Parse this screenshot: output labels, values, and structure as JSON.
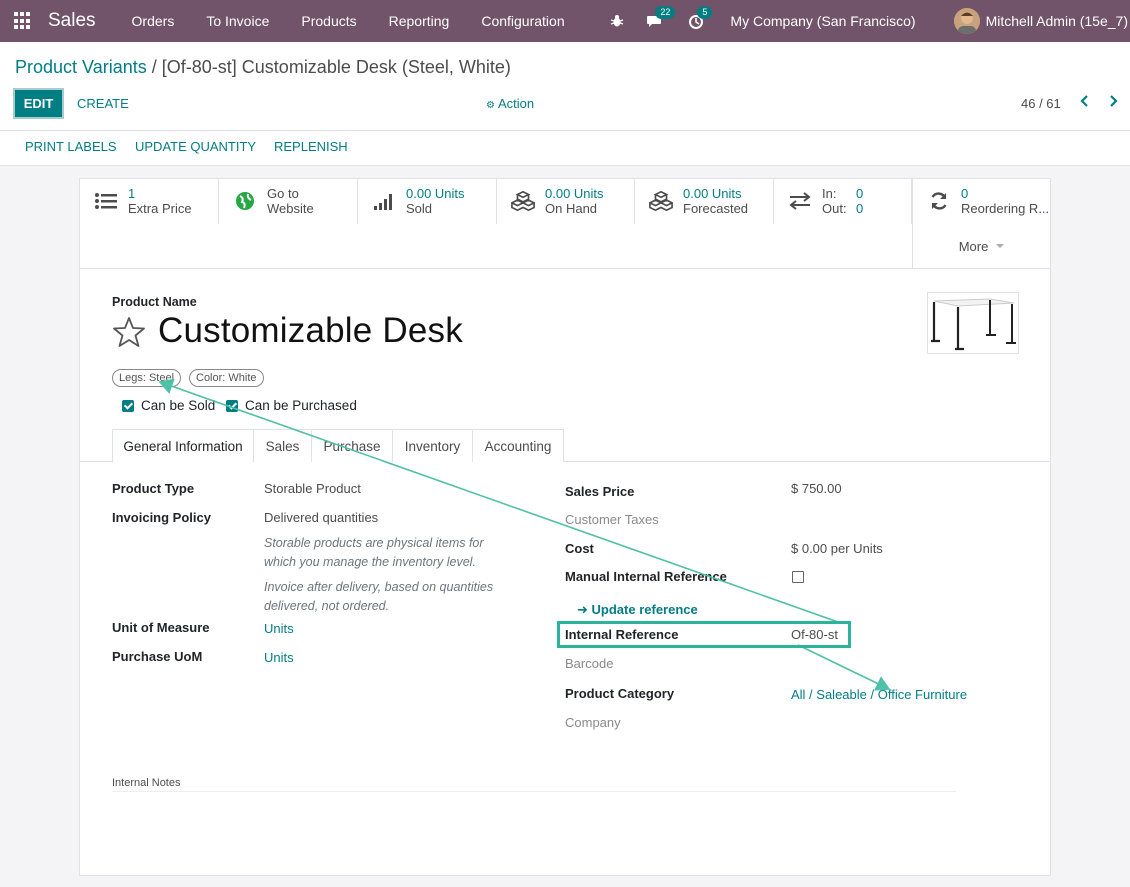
{
  "navbar": {
    "brand": "Sales",
    "menu": [
      "Orders",
      "To Invoice",
      "Products",
      "Reporting",
      "Configuration"
    ],
    "chat_badge": "22",
    "activity_badge": "5",
    "company": "My Company (San Francisco)",
    "user": "Mitchell Admin (15e_7)"
  },
  "breadcrumb": {
    "parent": "Product Variants",
    "separator": "/",
    "current": "[Of-80-st] Customizable Desk (Steel, White)"
  },
  "toolbar": {
    "edit": "EDIT",
    "create": "CREATE",
    "action": "Action",
    "pager": "46 / 61"
  },
  "statusbar": {
    "buttons": [
      "PRINT LABELS",
      "UPDATE QUANTITY",
      "REPLENISH"
    ]
  },
  "smart_buttons": {
    "extra_price_value": "1",
    "extra_price_label": "Extra Price",
    "website_line1": "Go to",
    "website_line2": "Website",
    "sold_value": "0.00 Units",
    "sold_label": "Sold",
    "onhand_value": "0.00 Units",
    "onhand_label": "On Hand",
    "forecast_value": "0.00 Units",
    "forecast_label": "Forecasted",
    "in_label": "In:",
    "in_value": "0",
    "out_label": "Out:",
    "out_value": "0",
    "reorder_value": "0",
    "reorder_label": "Reordering R...",
    "more": "More"
  },
  "product": {
    "name_label": "Product Name",
    "name": "Customizable Desk",
    "tags": [
      "Legs: Steel",
      "Color: White"
    ],
    "can_be_sold": "Can be Sold",
    "can_be_purchased": "Can be Purchased"
  },
  "tabs": [
    "General Information",
    "Sales",
    "Purchase",
    "Inventory",
    "Accounting"
  ],
  "general": {
    "product_type_label": "Product Type",
    "product_type": "Storable Product",
    "invoicing_policy_label": "Invoicing Policy",
    "invoicing_policy": "Delivered quantities",
    "help1_line1": "Storable products are physical items for",
    "help1_line2": "which you manage the inventory level.",
    "help2_line1": "Invoice after delivery, based on quantities",
    "help2_line2": "delivered, not ordered.",
    "uom_label": "Unit of Measure",
    "uom": "Units",
    "purchase_uom_label": "Purchase UoM",
    "purchase_uom": "Units",
    "sales_price_label": "Sales Price",
    "sales_price": "$ 750.00",
    "customer_taxes_label": "Customer Taxes",
    "cost_label": "Cost",
    "cost": "$ 0.00",
    "cost_unit": "per Units",
    "manual_ref_label": "Manual Internal Reference",
    "update_reference": "Update reference",
    "internal_ref_label": "Internal Reference",
    "internal_ref": "Of-80-st",
    "barcode_label": "Barcode",
    "category_label": "Product Category",
    "category": "All / Saleable / Office Furniture",
    "company_label": "Company"
  },
  "notes": {
    "label": "Internal Notes"
  },
  "colors": {
    "navbar": "#71536a",
    "primary": "#017e84",
    "highlight": "#2bb49a"
  }
}
